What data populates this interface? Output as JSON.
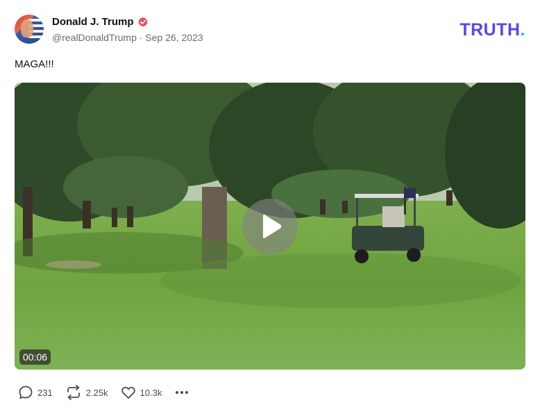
{
  "post": {
    "display_name": "Donald J. Trump",
    "handle_date": "@realDonaldTrump · Sep 26, 2023",
    "text": "MAGA!!!"
  },
  "brand": {
    "logo_main": "TRUTH",
    "logo_dot": ".",
    "color": "#5448ee",
    "dot_color": "#17c6a0"
  },
  "video": {
    "duration": "00:06"
  },
  "stats": {
    "replies": "231",
    "retruths": "2.25k",
    "likes": "10.3k"
  },
  "icons": [
    "verified-badge-icon",
    "play-icon",
    "reply-icon",
    "retruth-icon",
    "heart-icon",
    "more-icon"
  ]
}
